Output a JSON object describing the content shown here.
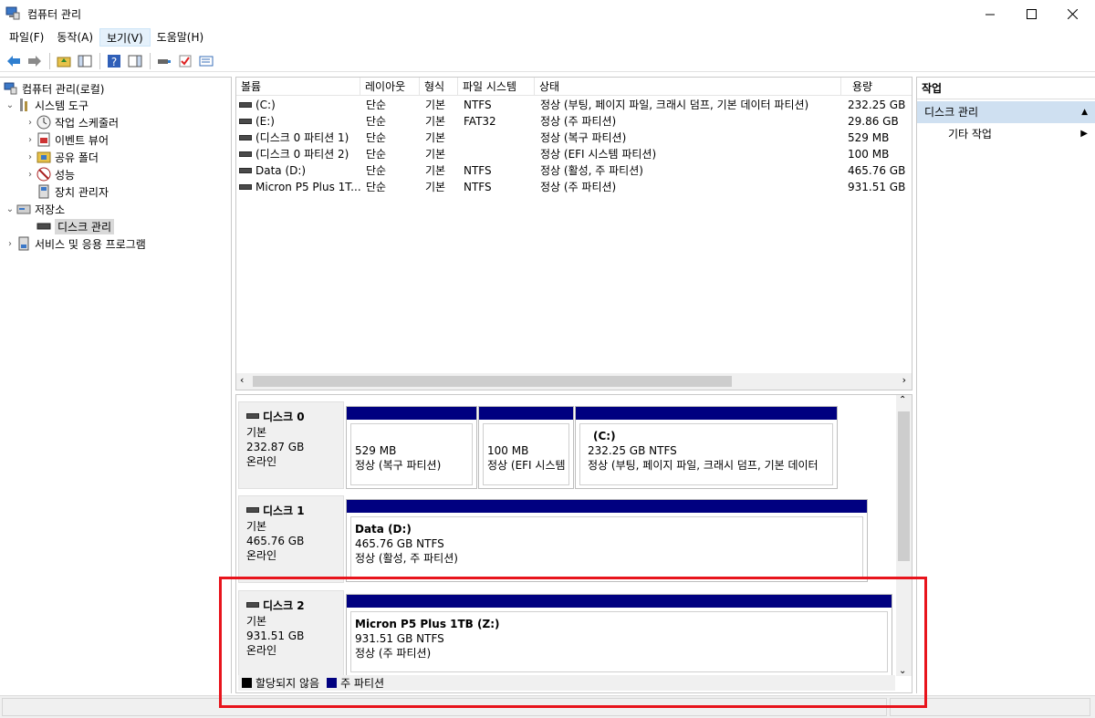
{
  "window": {
    "title": "컴퓨터 관리"
  },
  "menu": [
    "파일(F)",
    "동작(A)",
    "보기(V)",
    "도움말(H)"
  ],
  "tree": {
    "root": "컴퓨터 관리(로컬)",
    "system_tools": "시스템 도구",
    "task_scheduler": "작업 스케줄러",
    "event_viewer": "이벤트 뷰어",
    "shared_folders": "공유 폴더",
    "performance": "성능",
    "device_manager": "장치 관리자",
    "storage": "저장소",
    "disk_management": "디스크 관리",
    "services": "서비스 및 응용 프로그램"
  },
  "volume_list": {
    "columns": [
      "볼륨",
      "레이아웃",
      "형식",
      "파일 시스템",
      "상태",
      "용량"
    ],
    "rows": [
      {
        "volume": "(C:)",
        "layout": "단순",
        "type": "기본",
        "fs": "NTFS",
        "status": "정상 (부팅, 페이지 파일, 크래시 덤프, 기본 데이터 파티션)",
        "capacity": "232.25 GB"
      },
      {
        "volume": "(E:)",
        "layout": "단순",
        "type": "기본",
        "fs": "FAT32",
        "status": "정상 (주 파티션)",
        "capacity": "29.86 GB"
      },
      {
        "volume": "(디스크 0 파티션 1)",
        "layout": "단순",
        "type": "기본",
        "fs": "",
        "status": "정상 (복구 파티션)",
        "capacity": "529 MB"
      },
      {
        "volume": "(디스크 0 파티션 2)",
        "layout": "단순",
        "type": "기본",
        "fs": "",
        "status": "정상 (EFI 시스템 파티션)",
        "capacity": "100 MB"
      },
      {
        "volume": "Data (D:)",
        "layout": "단순",
        "type": "기본",
        "fs": "NTFS",
        "status": "정상 (활성, 주 파티션)",
        "capacity": "465.76 GB"
      },
      {
        "volume": "Micron P5 Plus 1T...",
        "layout": "단순",
        "type": "기본",
        "fs": "NTFS",
        "status": "정상 (주 파티션)",
        "capacity": "931.51 GB"
      }
    ]
  },
  "disks": [
    {
      "name": "디스크 0",
      "kind": "기본",
      "size": "232.87 GB",
      "state": "온라인",
      "partitions": [
        {
          "title": "",
          "size": "529 MB",
          "status": "정상 (복구 파티션)"
        },
        {
          "title": "",
          "size": "100 MB",
          "status": "정상 (EFI 시스템"
        },
        {
          "title": "(C:)",
          "size": "232.25 GB NTFS",
          "status": "정상 (부팅, 페이지 파일, 크래시 덤프, 기본 데이터"
        }
      ]
    },
    {
      "name": "디스크 1",
      "kind": "기본",
      "size": "465.76 GB",
      "state": "온라인",
      "partitions": [
        {
          "title": "Data  (D:)",
          "size": "465.76 GB NTFS",
          "status": "정상 (활성, 주 파티션)"
        }
      ]
    },
    {
      "name": "디스크 2",
      "kind": "기본",
      "size": "931.51 GB",
      "state": "온라인",
      "partitions": [
        {
          "title": "Micron P5 Plus 1TB  (Z:)",
          "size": "931.51 GB NTFS",
          "status": "정상 (주 파티션)"
        }
      ]
    }
  ],
  "legend": {
    "unallocated": "할당되지 않음",
    "primary": "주 파티션",
    "unallocated_color": "#000000",
    "primary_color": "#000080"
  },
  "actions": {
    "header": "작업",
    "section": "디스크 관리",
    "more": "기타 작업"
  },
  "colors": {
    "highlight": "#e8141c",
    "partition_bar": "#000080",
    "action_section": "#cfe0f1"
  }
}
